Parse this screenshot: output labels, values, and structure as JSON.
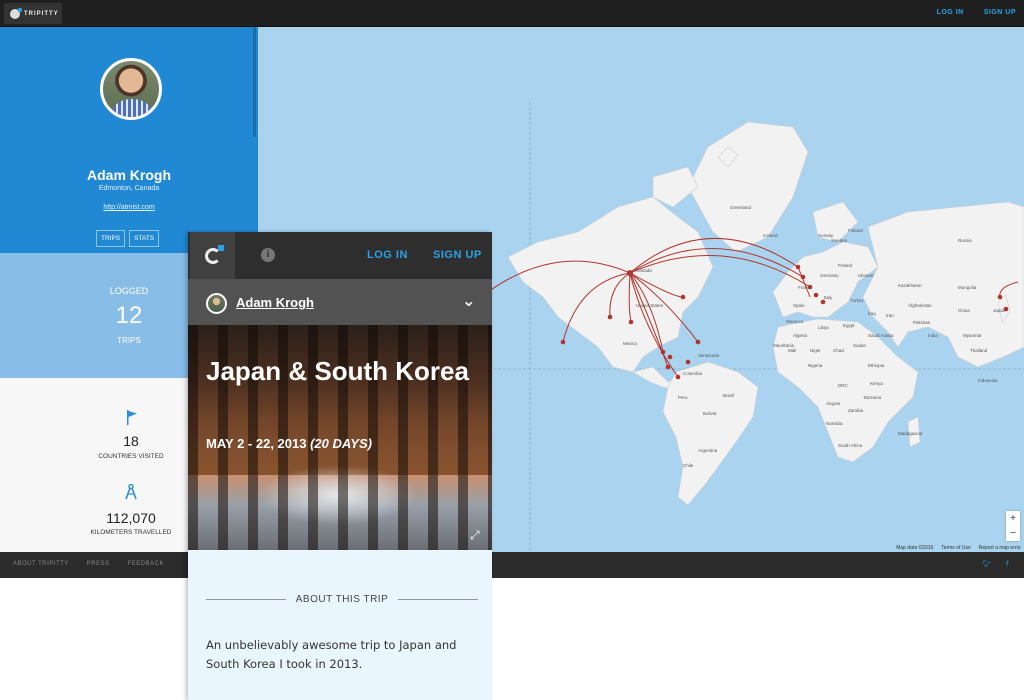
{
  "topbar": {
    "brand": "TRIPITTY",
    "login": "LOG IN",
    "signup": "SIGN UP"
  },
  "profile": {
    "name": "Adam Krogh",
    "location": "Edmonton, Canada",
    "url": "http://atmist.com",
    "buttons": [
      "TRIPS",
      "STATS"
    ]
  },
  "logged": {
    "label": "LOGGED",
    "count": "12",
    "unit": "TRIPS"
  },
  "stats": {
    "countries": "18",
    "countries_label": "COUNTRIES VISITED",
    "km": "112,070",
    "km_label": "KILOMETERS TRAVELLED"
  },
  "footer": {
    "links": [
      "ABOUT TRIPITTY",
      "PRESS",
      "FEEDBACK"
    ]
  },
  "map": {
    "attribution": [
      "Map data ©2016",
      "Terms of Use",
      "Report a map error"
    ],
    "zoom_in": "+",
    "zoom_out": "−",
    "labels": [
      "Greenland",
      "Canada",
      "United States",
      "Mexico",
      "Venezuela",
      "Colombia",
      "Peru",
      "Brazil",
      "Bolivia",
      "Argentina",
      "Chile",
      "Russia",
      "Kazakhstan",
      "Mongolia",
      "China",
      "India",
      "Iran",
      "Saudi Arabia",
      "Egypt",
      "Libya",
      "Algeria",
      "Mali",
      "Niger",
      "Chad",
      "Sudan",
      "Nigeria",
      "Ethiopia",
      "Kenya",
      "DRC",
      "Tanzania",
      "Angola",
      "Zambia",
      "Namibia",
      "South Africa",
      "Madagascar",
      "Turkey",
      "Iraq",
      "Afghanistan",
      "Pakistan",
      "Myanmar",
      "Thailand",
      "Indonesia",
      "Norway",
      "Sweden",
      "Finland",
      "Iceland",
      "Poland",
      "Ukraine",
      "Spain",
      "France",
      "Germany",
      "Italy",
      "Morocco",
      "Mauritania",
      "Japan"
    ]
  },
  "mobile": {
    "login": "LOG IN",
    "signup": "SIGN UP",
    "user": "Adam Krogh",
    "trip_title": "Japan & South Korea",
    "trip_dates": "MAY 2 - 22, 2013",
    "trip_days": "(20 DAYS)",
    "about_heading": "ABOUT THIS TRIP",
    "description": "An unbelievably awesome trip to Japan and South Korea I took in 2013."
  },
  "colors": {
    "accent": "#29a3e6",
    "profile_bg": "#2188d3",
    "route": "#b3342a",
    "ocean": "#a9d3ef",
    "land": "#f2f2f2"
  }
}
